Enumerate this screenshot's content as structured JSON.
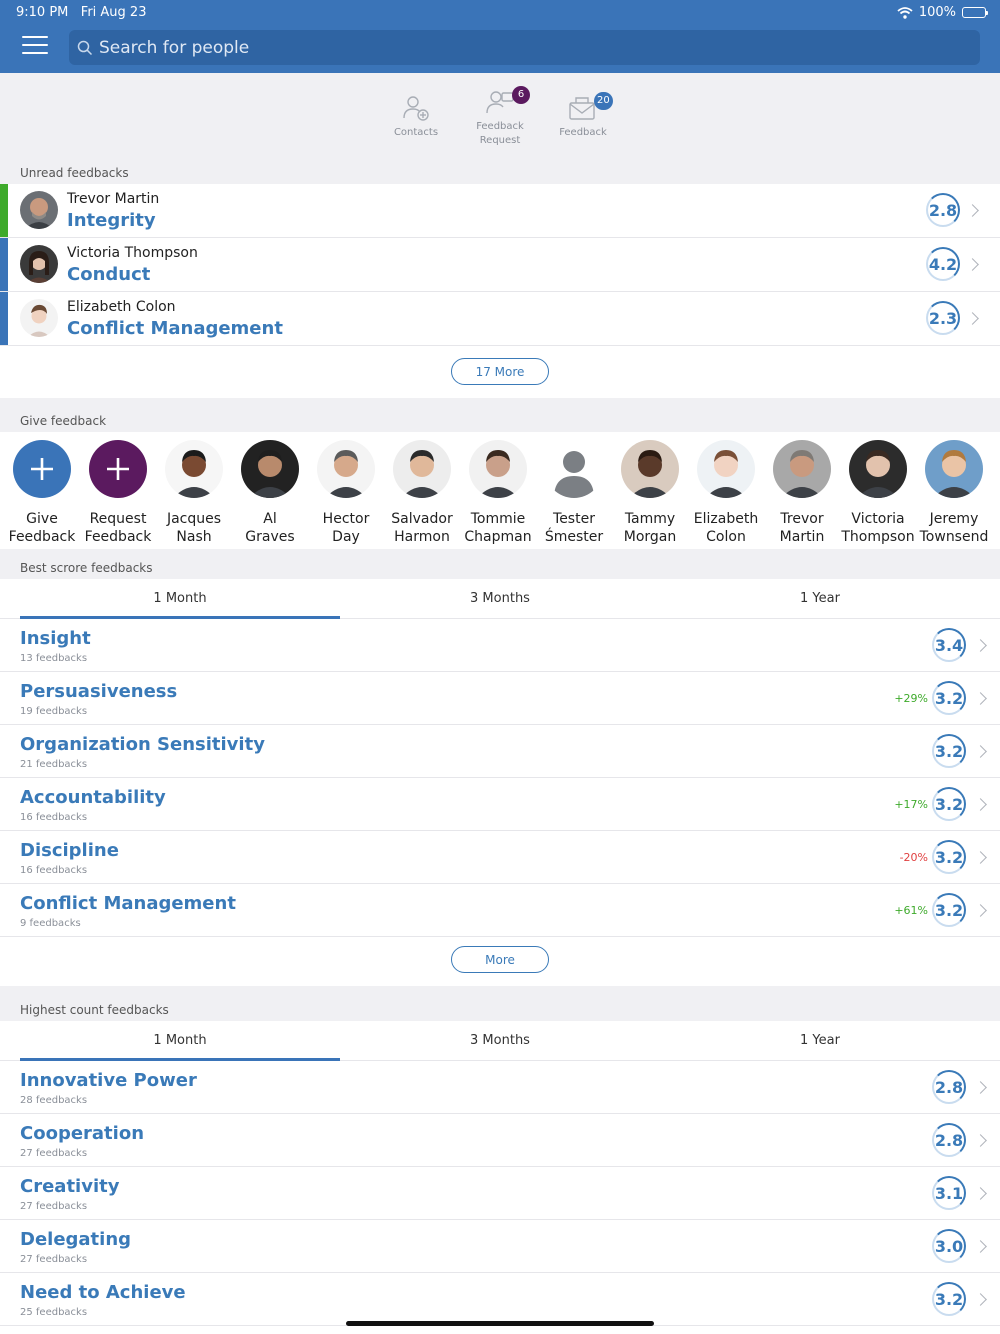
{
  "status": {
    "time": "9:10 PM",
    "date": "Fri Aug 23",
    "battery": "100%"
  },
  "search": {
    "placeholder": "Search for people"
  },
  "nav": {
    "contacts": {
      "label": "Contacts"
    },
    "feedback_request": {
      "label_line1": "Feedback",
      "label_line2": "Request",
      "badge": "6",
      "badge_color": "#5b1a5f"
    },
    "feedback": {
      "label": "Feedback",
      "badge": "20",
      "badge_color": "#3a74b8"
    }
  },
  "unread": {
    "label": "Unread feedbacks",
    "items": [
      {
        "name": "Trevor Martin",
        "topic": "Integrity",
        "score": "2.8",
        "stripe": "#3eaa2b"
      },
      {
        "name": "Victoria Thompson",
        "topic": "Conduct",
        "score": "4.2",
        "stripe": "#3a74b8"
      },
      {
        "name": "Elizabeth Colon",
        "topic": "Conflict Management",
        "score": "2.3",
        "stripe": "#3a74b8"
      }
    ],
    "more_label": "17 More"
  },
  "give": {
    "label": "Give feedback",
    "actions": [
      {
        "line1": "Give",
        "line2": "Feedback",
        "color": "#3a74b8"
      },
      {
        "line1": "Request",
        "line2": "Feedback",
        "color": "#5b1a5f"
      }
    ],
    "people": [
      {
        "line1": "Jacques",
        "line2": "Nash"
      },
      {
        "line1": "Al",
        "line2": "Graves"
      },
      {
        "line1": "Hector",
        "line2": "Day"
      },
      {
        "line1": "Salvador",
        "line2": "Harmon"
      },
      {
        "line1": "Tommie",
        "line2": "Chapman"
      },
      {
        "line1": "Tester",
        "line2": "Śmester"
      },
      {
        "line1": "Tammy",
        "line2": "Morgan"
      },
      {
        "line1": "Elizabeth",
        "line2": "Colon"
      },
      {
        "line1": "Trevor",
        "line2": "Martin"
      },
      {
        "line1": "Victoria",
        "line2": "Thompson"
      },
      {
        "line1": "Jeremy",
        "line2": "Townsend"
      }
    ]
  },
  "best": {
    "label": "Best scrore feedbacks",
    "tabs": [
      "1 Month",
      "3 Months",
      "1 Year"
    ],
    "items": [
      {
        "name": "Insight",
        "count": "13 feedbacks",
        "score": "3.4",
        "delta": ""
      },
      {
        "name": "Persuasiveness",
        "count": "19 feedbacks",
        "score": "3.2",
        "delta": "+29%"
      },
      {
        "name": "Organization Sensitivity",
        "count": "21 feedbacks",
        "score": "3.2",
        "delta": ""
      },
      {
        "name": "Accountability",
        "count": "16 feedbacks",
        "score": "3.2",
        "delta": "+17%"
      },
      {
        "name": "Discipline",
        "count": "16 feedbacks",
        "score": "3.2",
        "delta": "-20%"
      },
      {
        "name": "Conflict Management",
        "count": "9 feedbacks",
        "score": "3.2",
        "delta": "+61%"
      }
    ],
    "more_label": "More"
  },
  "highest": {
    "label": "Highest count feedbacks",
    "tabs": [
      "1 Month",
      "3 Months",
      "1 Year"
    ],
    "items": [
      {
        "name": "Innovative Power",
        "count": "28 feedbacks",
        "score": "2.8"
      },
      {
        "name": "Cooperation",
        "count": "27 feedbacks",
        "score": "2.8"
      },
      {
        "name": "Creativity",
        "count": "27 feedbacks",
        "score": "3.1"
      },
      {
        "name": "Delegating",
        "count": "27 feedbacks",
        "score": "3.0"
      },
      {
        "name": "Need to Achieve",
        "count": "25 feedbacks",
        "score": "3.2"
      }
    ]
  },
  "colors": {
    "accent": "#3a74b8",
    "positive": "#3eaa2b",
    "negative": "#e04040"
  }
}
